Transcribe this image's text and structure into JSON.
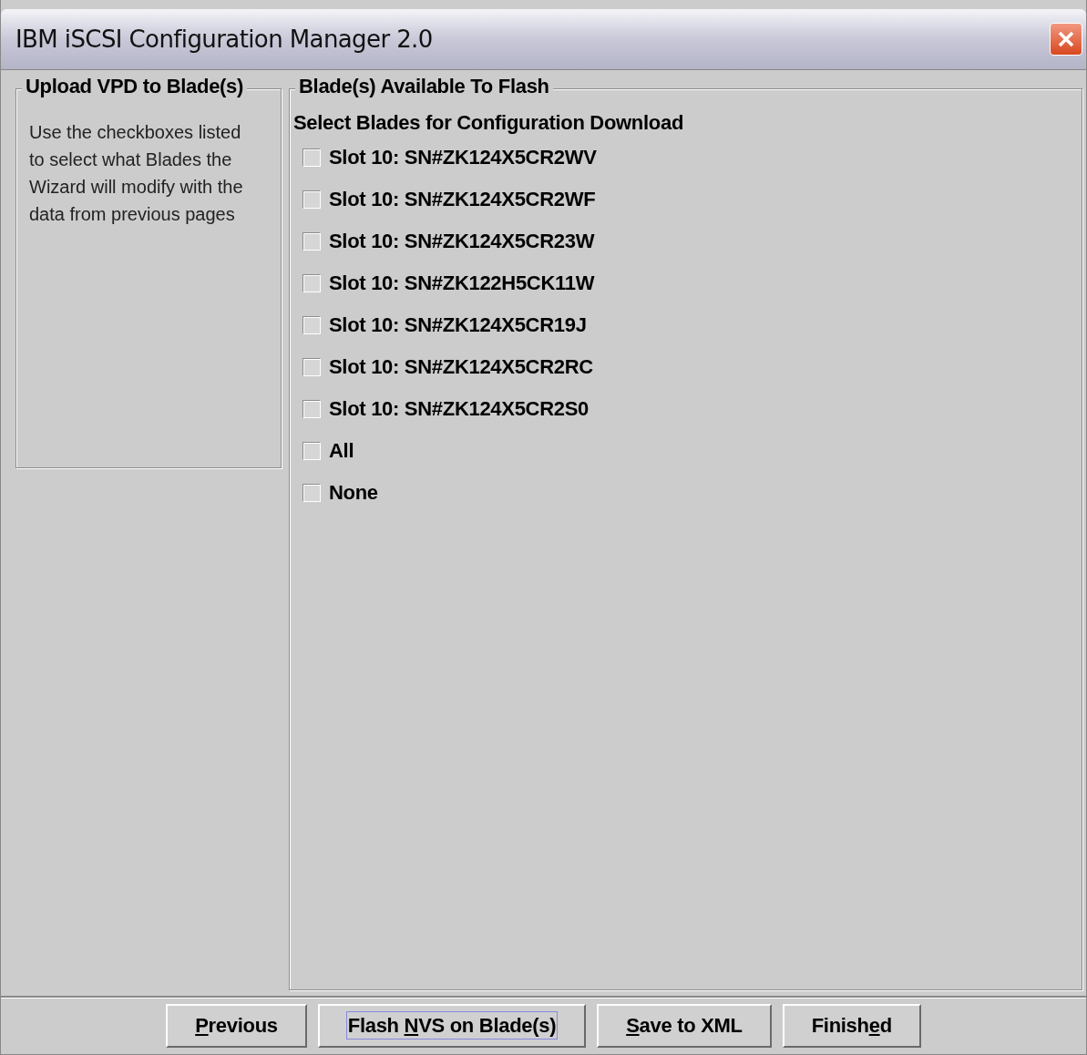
{
  "window": {
    "title": "IBM iSCSI Configuration Manager 2.0"
  },
  "left_panel": {
    "title": "Upload VPD to Blade(s)",
    "text": "Use the checkboxes listed to select what Blades the Wizard will modify with the data from previous pages"
  },
  "right_panel": {
    "title": "Blade(s) Available To Flash",
    "heading": "Select Blades for Configuration Download",
    "checkboxes": [
      {
        "label": "Slot 10: SN#ZK124X5CR2WV",
        "checked": false
      },
      {
        "label": "Slot 10: SN#ZK124X5CR2WF",
        "checked": false
      },
      {
        "label": "Slot 10: SN#ZK124X5CR23W",
        "checked": false
      },
      {
        "label": "Slot 10: SN#ZK122H5CK11W",
        "checked": false
      },
      {
        "label": "Slot 10: SN#ZK124X5CR19J",
        "checked": false
      },
      {
        "label": "Slot 10: SN#ZK124X5CR2RC",
        "checked": false
      },
      {
        "label": "Slot 10: SN#ZK124X5CR2S0",
        "checked": false
      },
      {
        "label": "All",
        "checked": false
      },
      {
        "label": "None",
        "checked": false
      }
    ]
  },
  "buttons": [
    {
      "label_parts": [
        {
          "text": "P",
          "underlined": true
        },
        {
          "text": "revious",
          "underlined": false
        }
      ],
      "focused": false
    },
    {
      "label_parts": [
        {
          "text": "Flash ",
          "underlined": false
        },
        {
          "text": "N",
          "underlined": true
        },
        {
          "text": "VS on Blade(s)",
          "underlined": false
        }
      ],
      "focused": true
    },
    {
      "label_parts": [
        {
          "text": "S",
          "underlined": true
        },
        {
          "text": "ave to XML",
          "underlined": false
        }
      ],
      "focused": false
    },
    {
      "label_parts": [
        {
          "text": "Finish",
          "underlined": false
        },
        {
          "text": "e",
          "underlined": true
        },
        {
          "text": "d",
          "underlined": false
        }
      ],
      "focused": false
    }
  ]
}
